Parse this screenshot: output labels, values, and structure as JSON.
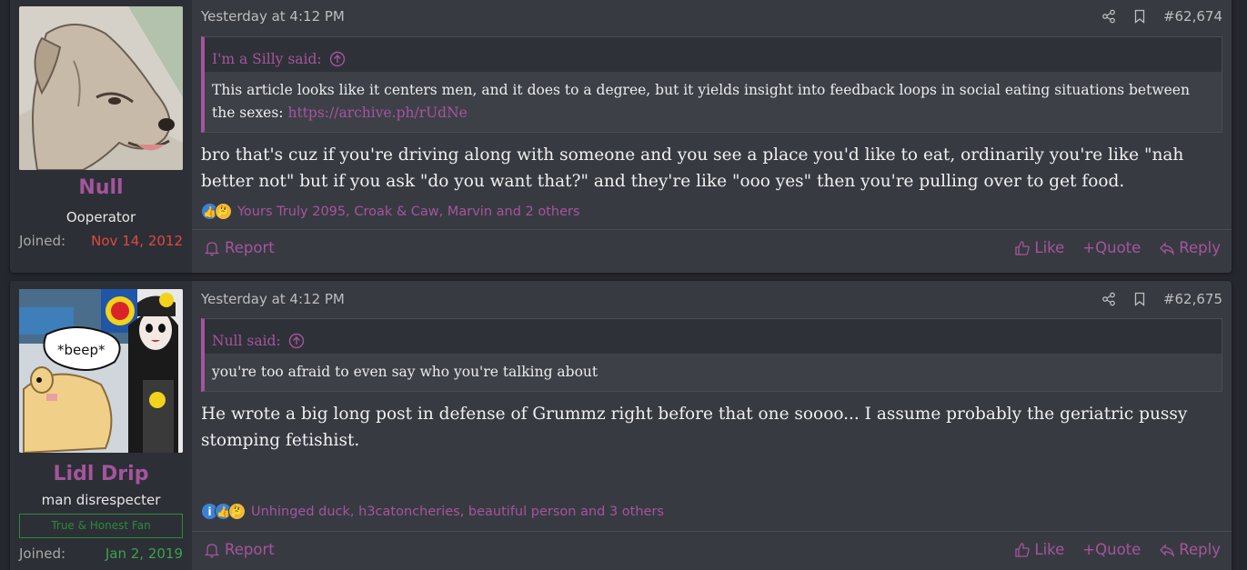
{
  "posts": [
    {
      "username": "Null",
      "user_title": "Ooperator",
      "joined_label": "Joined:",
      "joined_date": "Nov 14, 2012",
      "joined_color": "#e0483f",
      "time": "Yesterday at 4:12 PM",
      "post_number": "#62,674",
      "quote_author": "I'm a Silly said:",
      "quote_text": "This article looks like it centers men, and it does to a degree, but it yields insight into feedback loops in social eating situations between the sexes: ",
      "quote_link": "https://archive.ph/rUdNe",
      "message": "bro that's cuz if you're driving along with someone and you see a place you'd like to eat, ordinarily you're like \"nah better not\" but if you ask \"do you want that?\" and they're like \"ooo yes\" then you're pulling over to get food.",
      "reactions_text": "Yours Truly 2095, Croak & Caw, Marvin and 2 others",
      "reaction_icons": [
        "thumbs-up-icon",
        "thinking-face-icon"
      ],
      "report_label": "Report",
      "like_label": "Like",
      "quote_label": "+Quote",
      "reply_label": "Reply"
    },
    {
      "username": "Lidl Drip",
      "user_title": "man disrespecter",
      "banner": "True & Honest Fan",
      "joined_label": "Joined:",
      "joined_date": "Jan 2, 2019",
      "joined_color": "#3aa34a",
      "time": "Yesterday at 4:12 PM",
      "post_number": "#62,675",
      "quote_author": "Null said:",
      "quote_text": "you're too afraid to even say who you're talking about",
      "message": "He wrote a big long post in defense of Grummz right before that one soooo... I assume probably the geriatric pussy stomping fetishist.",
      "reactions_text": "Unhinged duck, h3catoncheries, beautiful person and 3 others",
      "reaction_icons": [
        "informative-icon",
        "thumbs-up-icon",
        "thinking-face-icon"
      ],
      "avatar_caption": "*beep*",
      "report_label": "Report",
      "like_label": "Like",
      "quote_label": "+Quote",
      "reply_label": "Reply"
    }
  ],
  "colors": {
    "accent": "#a4559c",
    "background": "#25272e",
    "post_body": "#383a42",
    "user_column": "#2d2f36"
  }
}
